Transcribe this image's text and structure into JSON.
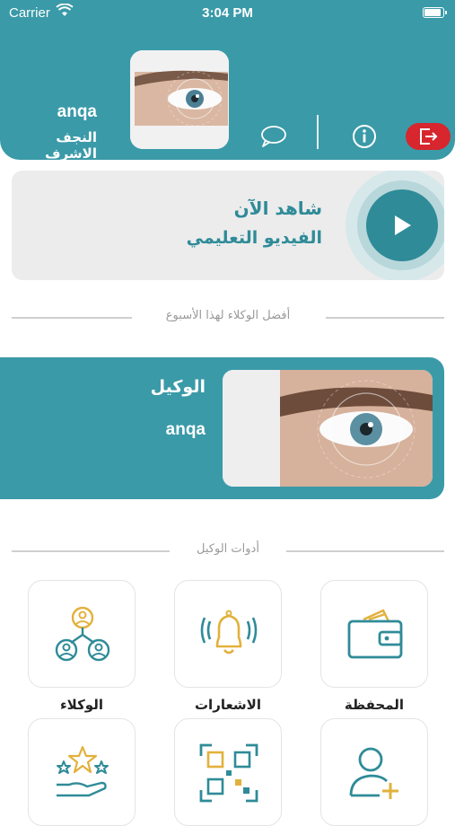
{
  "status_bar": {
    "carrier": "Carrier",
    "time": "3:04 PM"
  },
  "header": {
    "user_name": "anqa",
    "user_city": "النجف الاشرف",
    "icons": [
      "chat-icon",
      "info-icon",
      "logout-icon"
    ],
    "accent_color": "#3a9aa8",
    "logout_color": "#d7262e"
  },
  "video_card": {
    "title": "شاهد الآن",
    "subtitle": "الفيديو التعليمي"
  },
  "best_agents": {
    "section_title": "أفضل الوكلاء لهذا الأسبوع",
    "agent_label": "الوكيل",
    "agent_name": "anqa"
  },
  "tools": {
    "section_title": "أدوات الوكيل",
    "items": [
      {
        "label": "المحفظة",
        "icon": "wallet-icon"
      },
      {
        "label": "الاشعارات",
        "icon": "bell-icon"
      },
      {
        "label": "الوكلاء",
        "icon": "agents-network-icon"
      },
      {
        "label": "",
        "icon": "add-user-icon"
      },
      {
        "label": "",
        "icon": "qr-code-icon"
      },
      {
        "label": "",
        "icon": "rating-stars-icon"
      }
    ]
  }
}
